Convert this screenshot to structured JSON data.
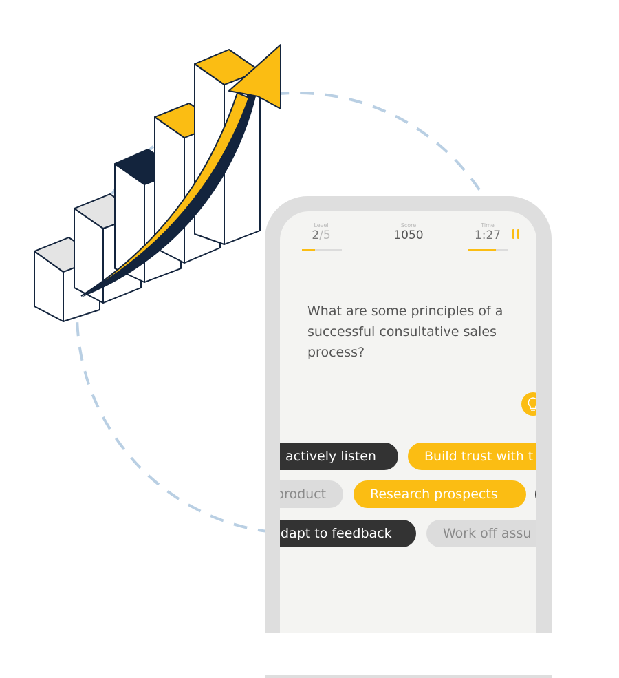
{
  "colors": {
    "accent": "#fbbd13",
    "dark": "#333333",
    "navy": "#13243d",
    "dashed_circle": "#b9cfe3"
  },
  "header": {
    "level_label": "Level",
    "level_current": "2",
    "level_total": "/5",
    "level_progress": 0.2,
    "score_label": "Score",
    "score_value": "1050",
    "time_label": "Time",
    "time_value": "1:27",
    "time_progress": 0.7,
    "pause_icon": "pause-icon"
  },
  "question": "What are some principles of a successful consultative sales process?",
  "hint_icon": "lightbulb-icon",
  "chips": [
    {
      "text": "actively listen",
      "state": "dark"
    },
    {
      "text": "Build trust with t",
      "state": "selected"
    },
    {
      "text": "product",
      "state": "struck"
    },
    {
      "text": "Research prospects",
      "state": "selected"
    },
    {
      "text": "dapt to feedback",
      "state": "dark"
    },
    {
      "text": "Work off assu",
      "state": "struck"
    }
  ]
}
